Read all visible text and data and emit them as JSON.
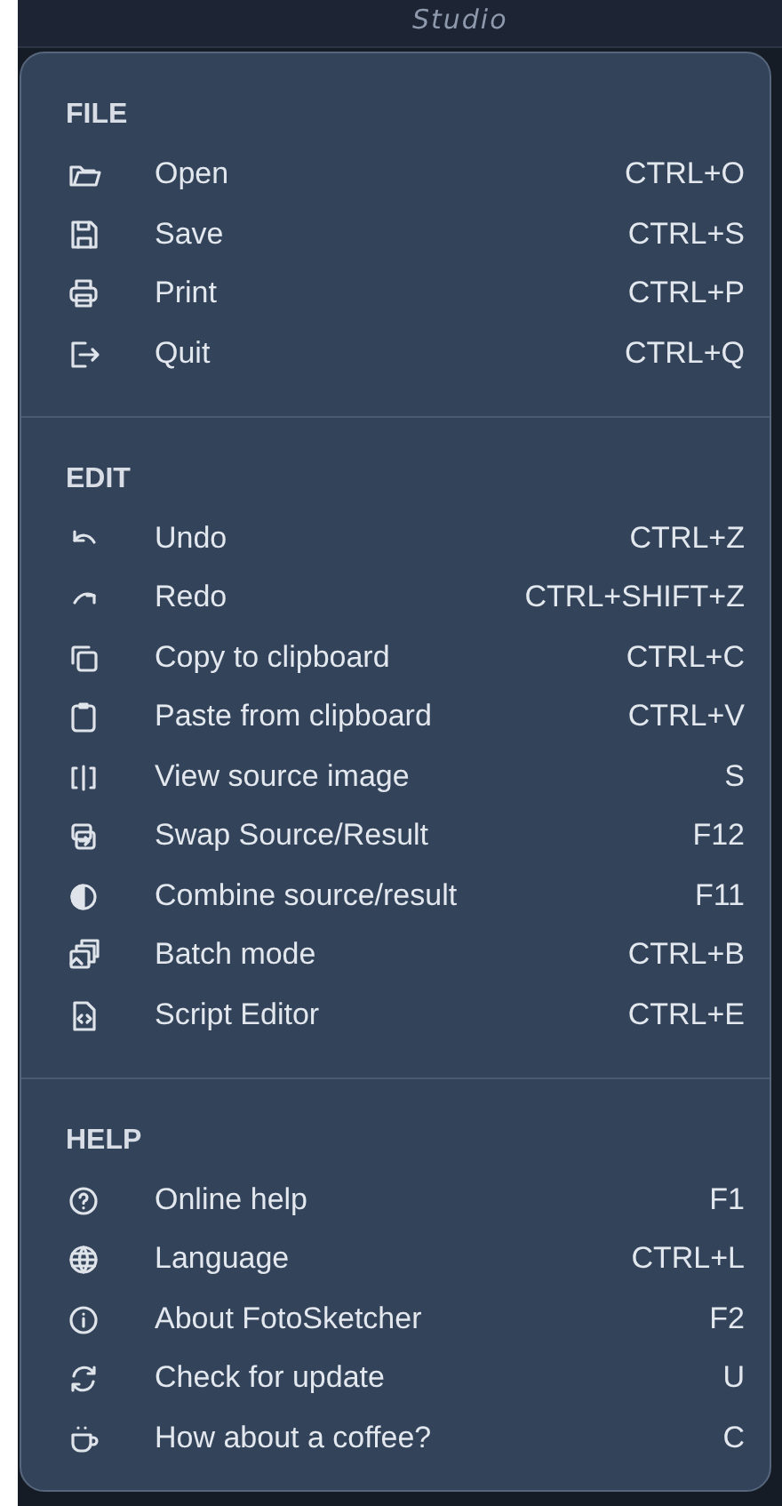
{
  "backdrop": {
    "title": "Studio"
  },
  "menu": {
    "sections": [
      {
        "heading": "FILE",
        "items": [
          {
            "label": "Open",
            "shortcut": "CTRL+O"
          },
          {
            "label": "Save",
            "shortcut": "CTRL+S"
          },
          {
            "label": "Print",
            "shortcut": "CTRL+P"
          },
          {
            "label": "Quit",
            "shortcut": "CTRL+Q"
          }
        ]
      },
      {
        "heading": "EDIT",
        "items": [
          {
            "label": "Undo",
            "shortcut": "CTRL+Z"
          },
          {
            "label": "Redo",
            "shortcut": "CTRL+SHIFT+Z"
          },
          {
            "label": "Copy to clipboard",
            "shortcut": "CTRL+C"
          },
          {
            "label": "Paste from clipboard",
            "shortcut": "CTRL+V"
          },
          {
            "label": "View source image",
            "shortcut": "S"
          },
          {
            "label": "Swap Source/Result",
            "shortcut": "F12"
          },
          {
            "label": "Combine source/result",
            "shortcut": "F11"
          },
          {
            "label": "Batch mode",
            "shortcut": "CTRL+B"
          },
          {
            "label": "Script Editor",
            "shortcut": "CTRL+E"
          }
        ]
      },
      {
        "heading": "HELP",
        "items": [
          {
            "label": "Online help",
            "shortcut": "F1"
          },
          {
            "label": "Language",
            "shortcut": "CTRL+L"
          },
          {
            "label": "About FotoSketcher",
            "shortcut": "F2"
          },
          {
            "label": "Check for update",
            "shortcut": "U"
          },
          {
            "label": "How about a coffee?",
            "shortcut": "C"
          }
        ]
      }
    ]
  }
}
